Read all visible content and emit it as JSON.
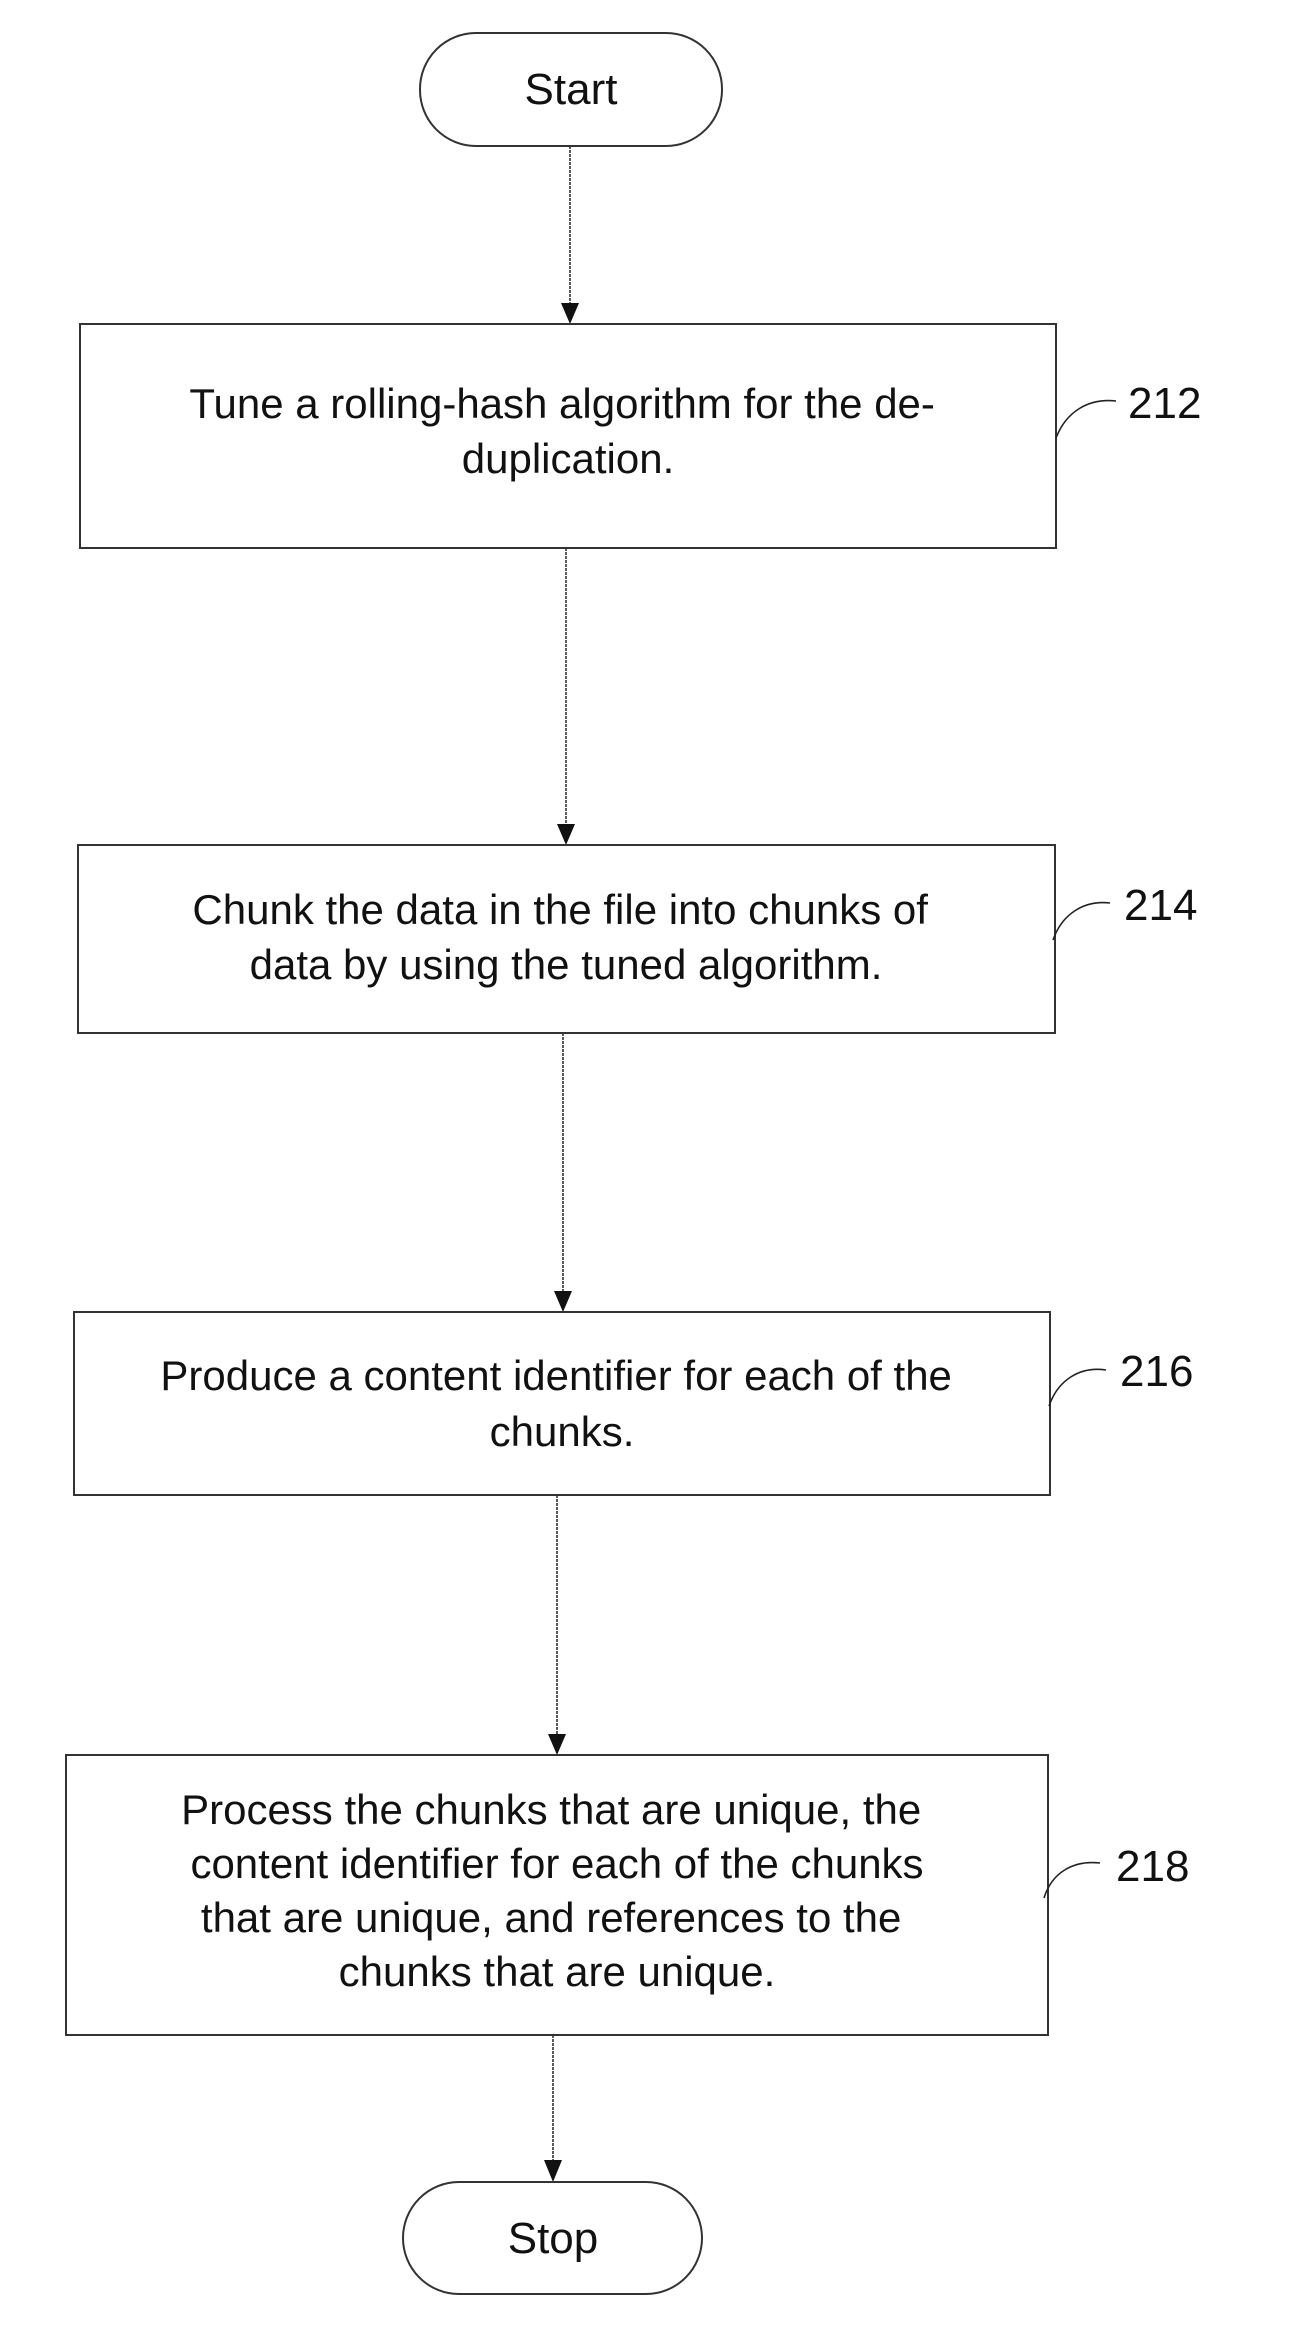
{
  "diagram": {
    "type": "flowchart",
    "start": {
      "label": "Start"
    },
    "steps": [
      {
        "ref": "212",
        "lines": [
          "Tune a rolling-hash algorithm for the de-",
          "duplication."
        ]
      },
      {
        "ref": "214",
        "lines": [
          "Chunk the data in the file into chunks of",
          "data by using the tuned algorithm."
        ]
      },
      {
        "ref": "216",
        "lines": [
          "Produce a content identifier for each of the",
          "chunks."
        ]
      },
      {
        "ref": "218",
        "lines": [
          "Process the chunks that are unique, the",
          "content identifier for each of the chunks",
          "that are unique, and references to the",
          "chunks that are unique."
        ]
      }
    ],
    "end": {
      "label": "Stop"
    },
    "colors": {
      "ink": "#111111",
      "background": "#ffffff"
    }
  }
}
